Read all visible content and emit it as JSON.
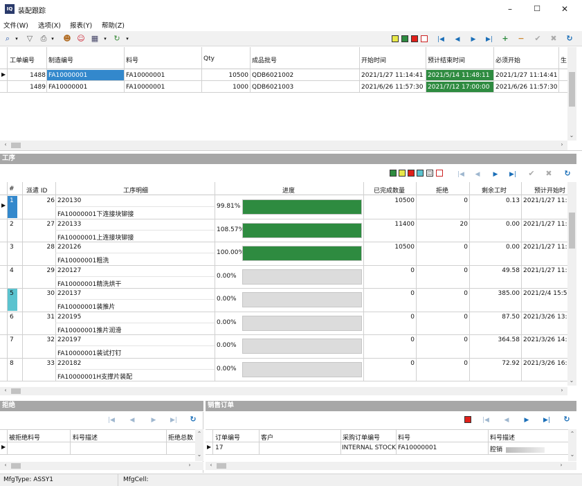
{
  "window": {
    "app_icon": "IQ",
    "title": "装配跟踪",
    "minimize": "–",
    "maximize": "☐",
    "close": "✕"
  },
  "menu": [
    "文件(W)",
    "选项(X)",
    "报表(Y)",
    "帮助(Z)"
  ],
  "colors": {
    "section_header": "#a7a7a7",
    "progress_fill": "#2e8b40",
    "selected_cell": "#3388cc",
    "highlight_green": "#2e8b40",
    "teal_row": "#5bc3cf"
  },
  "top_grid": {
    "headers": [
      "工单编号",
      "制造编号",
      "料号",
      "Qty",
      "成品批号",
      "开始时间",
      "预计结束时间",
      "必须开始",
      "生"
    ],
    "rows": [
      {
        "id": "1488",
        "mfg": "FA10000001",
        "part": "FA10000001",
        "qty": "10500",
        "lot": "QDB6021002",
        "start": "2021/1/27 11:14:41",
        "est_end": "2021/5/14 11:48:11",
        "must_start": "2021/1/27 11:14:41"
      },
      {
        "id": "1489",
        "mfg": "FA10000001",
        "part": "FA10000001",
        "qty": "1000",
        "lot": "QDB6021003",
        "start": "2021/6/26 11:57:30",
        "est_end": "2021/7/12 17:00:00",
        "must_start": "2021/6/26 11:57:30"
      }
    ]
  },
  "ops_section": {
    "title": "工序",
    "headers": [
      "#",
      "派遣 ID",
      "工序明细",
      "进度",
      "已完成数量",
      "拒绝",
      "剩余工时",
      "预计开始时"
    ],
    "rows": [
      {
        "num": "1",
        "dispatch": "26",
        "code": "220130",
        "desc": "FA10000001下连接块铆接",
        "pct": "99.81%",
        "progress": 0.9981,
        "done": "10500",
        "reject": "0",
        "remaining": "0.13",
        "est_start": "2021/1/27 11:1"
      },
      {
        "num": "2",
        "dispatch": "27",
        "code": "220133",
        "desc": "FA10000001上连接块铆接",
        "pct": "108.57%",
        "progress": 1.0,
        "done": "11400",
        "reject": "20",
        "remaining": "0.00",
        "est_start": "2021/1/27 11:2"
      },
      {
        "num": "3",
        "dispatch": "28",
        "code": "220126",
        "desc": "FA10000001粗洗",
        "pct": "100.00%",
        "progress": 1.0,
        "done": "10500",
        "reject": "0",
        "remaining": "0.00",
        "est_start": "2021/1/27 11:2"
      },
      {
        "num": "4",
        "dispatch": "29",
        "code": "220127",
        "desc": "FA10000001精洗烘干",
        "pct": "0.00%",
        "progress": 0.0,
        "done": "0",
        "reject": "0",
        "remaining": "49.58",
        "est_start": "2021/1/27 11:2"
      },
      {
        "num": "5",
        "dispatch": "30",
        "code": "220137",
        "desc": "FA10000001装推片",
        "pct": "0.00%",
        "progress": 0.0,
        "done": "0",
        "reject": "0",
        "remaining": "385.00",
        "est_start": "2021/2/4 15:5"
      },
      {
        "num": "6",
        "dispatch": "31",
        "code": "220195",
        "desc": "FA10000001推片润滑",
        "pct": "0.00%",
        "progress": 0.0,
        "done": "0",
        "reject": "0",
        "remaining": "87.50",
        "est_start": "2021/3/26 13:5"
      },
      {
        "num": "7",
        "dispatch": "32",
        "code": "220197",
        "desc": "FA10000001装试打钉",
        "pct": "0.00%",
        "progress": 0.0,
        "done": "0",
        "reject": "0",
        "remaining": "364.58",
        "est_start": "2021/3/26 14:2"
      },
      {
        "num": "8",
        "dispatch": "33",
        "code": "220182",
        "desc": "FA10000001H支撑片装配",
        "pct": "0.00%",
        "progress": 0.0,
        "done": "0",
        "reject": "0",
        "remaining": "72.92",
        "est_start": "2021/3/26 16:0"
      }
    ]
  },
  "reject_section": {
    "title": "拒绝",
    "headers": [
      "被拒绝料号",
      "料号描述",
      "拒绝总数"
    ]
  },
  "sales_section": {
    "title": "销售订单",
    "headers": [
      "订单编号",
      "客户",
      "采购订单编号",
      "料号",
      "料号描述"
    ],
    "rows": [
      {
        "order": "17",
        "customer": "",
        "po": "INTERNAL STOCK",
        "part": "FA10000001",
        "desc": "腔销"
      }
    ]
  },
  "status": {
    "mfg_type": "MfgType: ASSY1",
    "mfg_cell": "MfgCell:"
  }
}
